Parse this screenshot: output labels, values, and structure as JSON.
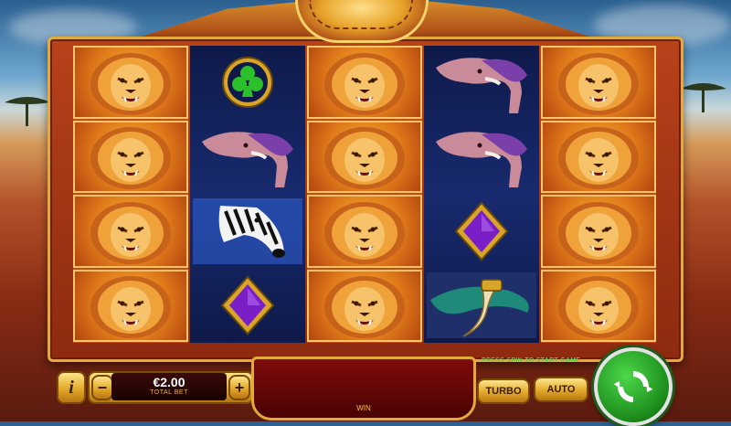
{
  "reels": [
    [
      "lion",
      "lion",
      "lion",
      "lion"
    ],
    [
      "club",
      "elephant",
      "zebra",
      "diamond"
    ],
    [
      "lion",
      "lion",
      "lion",
      "lion"
    ],
    [
      "elephant",
      "elephant",
      "diamond",
      "tusk"
    ],
    [
      "lion",
      "lion",
      "lion",
      "lion"
    ]
  ],
  "controls": {
    "info_label": "i",
    "minus_label": "−",
    "plus_label": "+",
    "bet_value": "€2.00",
    "bet_caption": "TOTAL BET",
    "win_caption": "WIN",
    "hint_text": "PRESS SPIN TO START GAME",
    "turbo_label": "TURBO",
    "auto_label": "AUTO"
  },
  "colors": {
    "spin_green": "#1b8a1a",
    "gold": "#e3a93b",
    "hint_green": "#35e04a"
  },
  "icons": {
    "spin": "refresh-arrows-icon",
    "lion": "lion-icon",
    "elephant": "elephant-icon",
    "zebra": "zebra-icon",
    "club": "club-suit-icon",
    "diamond": "diamond-suit-icon",
    "tusk": "tusk-necklace-icon"
  }
}
